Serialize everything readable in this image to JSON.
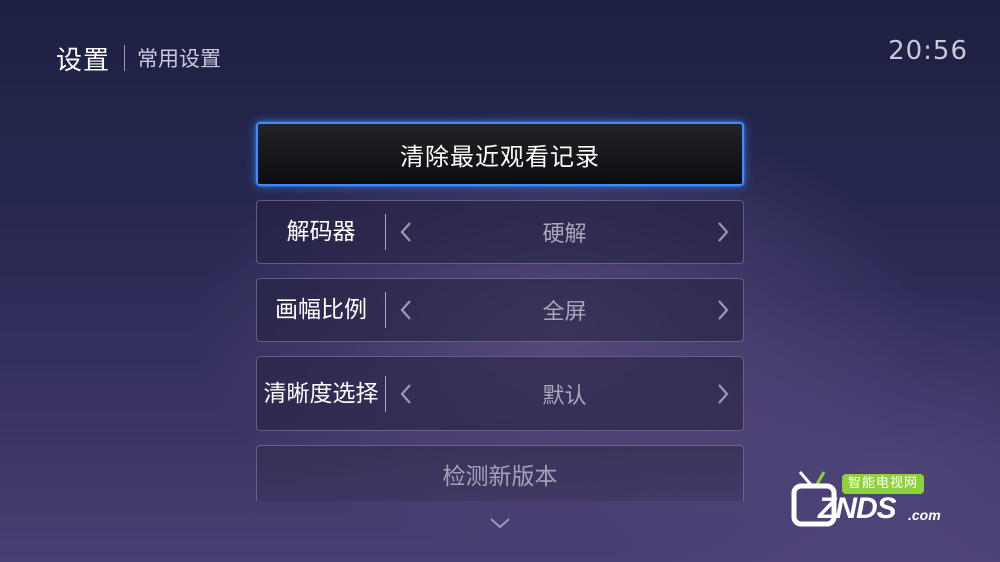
{
  "header": {
    "title": "设置",
    "subtitle": "常用设置"
  },
  "clock": "20:56",
  "menu": {
    "clear_history": "清除最近观看记录",
    "decoder": {
      "label": "解码器",
      "value": "硬解"
    },
    "aspect_ratio": {
      "label": "画幅比例",
      "value": "全屏"
    },
    "resolution": {
      "label": "清晰度选择",
      "value": "默认"
    },
    "check_update": "检测新版本"
  },
  "watermark": {
    "cn_text": "智能电视网",
    "brand": "ZNDS",
    "suffix": ".com"
  },
  "icons": {
    "prev": "chevron-left-icon",
    "next": "chevron-right-icon",
    "scroll": "chevron-down-icon"
  },
  "colors": {
    "focus_border": "#3d8cff",
    "watermark_accent": "#8fd13a"
  }
}
